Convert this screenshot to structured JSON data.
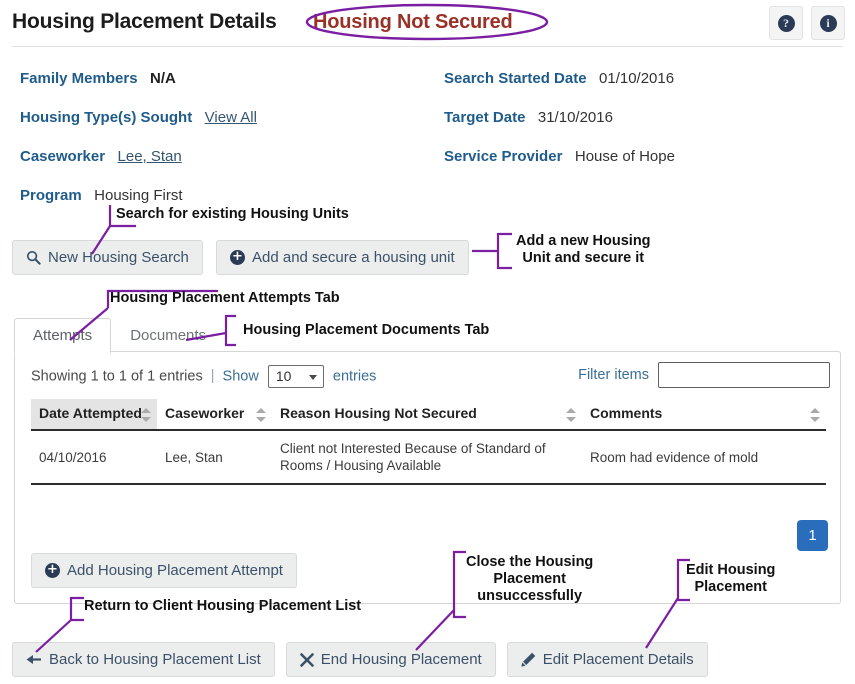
{
  "header": {
    "title": "Housing Placement Details",
    "status": "Housing Not Secured",
    "help_icon": "question-circle-icon",
    "info_icon": "info-circle-icon",
    "help_glyph": "?",
    "info_glyph": "i",
    "status_color": "#9a3126",
    "annotation_color": "#7b1fa2"
  },
  "details": {
    "left": [
      {
        "label": "Family Members",
        "value": "N/A",
        "kind": "strong"
      },
      {
        "label": "Housing Type(s) Sought",
        "value": "View All",
        "kind": "link"
      },
      {
        "label": "Caseworker",
        "value": "Lee, Stan",
        "kind": "link"
      },
      {
        "label": "Program",
        "value": "Housing First",
        "kind": "plain"
      }
    ],
    "right": [
      {
        "label": "Search Started Date",
        "value": "01/10/2016",
        "kind": "plain"
      },
      {
        "label": "Target Date",
        "value": "31/10/2016",
        "kind": "plain"
      },
      {
        "label": "Service Provider",
        "value": "House of Hope",
        "kind": "plain"
      }
    ]
  },
  "actions": {
    "new_search": "New Housing Search",
    "new_search_icon": "search-icon",
    "add_secure": "Add and secure a housing unit",
    "add_secure_icon": "plus-circle-icon"
  },
  "tabs": [
    {
      "label": "Attempts",
      "active": true
    },
    {
      "label": "Documents",
      "active": false
    }
  ],
  "table_controls": {
    "showing": "Showing 1 to 1 of 1 entries",
    "separator": "|",
    "show_label": "Show",
    "page_length": "10",
    "entries_label": "entries",
    "filter_label": "Filter items",
    "filter_value": "",
    "filter_placeholder": ""
  },
  "table": {
    "columns": [
      {
        "label": "Date Attempted",
        "sorted": true
      },
      {
        "label": "Caseworker",
        "sorted": false
      },
      {
        "label": "Reason Housing Not Secured",
        "sorted": false
      },
      {
        "label": "Comments",
        "sorted": false
      }
    ],
    "rows": [
      {
        "date_attempted": "04/10/2016",
        "caseworker": "Lee, Stan",
        "reason": "Client not Interested Because of Standard of Rooms / Housing Available",
        "comments": "Room had evidence of mold"
      }
    ]
  },
  "pagination": {
    "current_page": "1"
  },
  "panel_actions": {
    "add_attempt": "Add Housing Placement Attempt",
    "add_attempt_icon": "plus-circle-icon"
  },
  "footer": {
    "back": "Back to Housing Placement List",
    "back_icon": "arrow-left-icon",
    "end": "End Housing Placement",
    "end_icon": "close-x-icon",
    "edit": "Edit Placement Details",
    "edit_icon": "pencil-icon"
  },
  "annotations": [
    {
      "id": "ann-search-units",
      "text": "Search for existing Housing Units"
    },
    {
      "id": "ann-add-unit",
      "text": "Add a new Housing\nUnit and secure it"
    },
    {
      "id": "ann-attempts-tab",
      "text": "Housing Placement Attempts Tab"
    },
    {
      "id": "ann-documents-tab",
      "text": "Housing Placement Documents Tab"
    },
    {
      "id": "ann-return-list",
      "text": "Return to Client Housing Placement List"
    },
    {
      "id": "ann-close-unsucc",
      "text": "Close the Housing\nPlacement\nunsuccessfully"
    },
    {
      "id": "ann-edit-placement",
      "text": "Edit Housing\nPlacement"
    }
  ]
}
